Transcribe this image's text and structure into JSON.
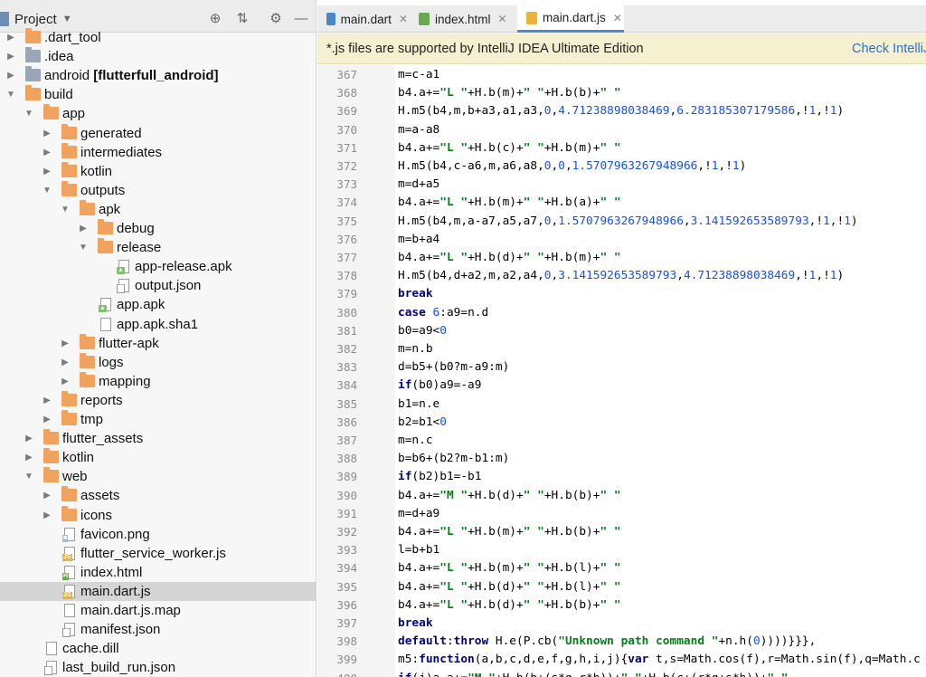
{
  "project_panel": {
    "title": "Project",
    "tree": [
      {
        "label": ".dart_tool",
        "depth": 1,
        "expander": "collapsed",
        "icon": "folder"
      },
      {
        "label": ".idea",
        "depth": 1,
        "expander": "collapsed",
        "icon": "folder-grey"
      },
      {
        "label": "android",
        "bold_suffix": "[flutterfull_android]",
        "depth": 1,
        "expander": "collapsed",
        "icon": "folder-grey"
      },
      {
        "label": "build",
        "depth": 1,
        "expander": "expanded",
        "icon": "folder"
      },
      {
        "label": "app",
        "depth": 2,
        "expander": "expanded",
        "icon": "folder"
      },
      {
        "label": "generated",
        "depth": 3,
        "expander": "collapsed",
        "icon": "folder"
      },
      {
        "label": "intermediates",
        "depth": 3,
        "expander": "collapsed",
        "icon": "folder"
      },
      {
        "label": "kotlin",
        "depth": 3,
        "expander": "collapsed",
        "icon": "folder"
      },
      {
        "label": "outputs",
        "depth": 3,
        "expander": "expanded",
        "icon": "folder"
      },
      {
        "label": "apk",
        "depth": 4,
        "expander": "expanded",
        "icon": "folder"
      },
      {
        "label": "debug",
        "depth": 5,
        "expander": "collapsed",
        "icon": "folder"
      },
      {
        "label": "release",
        "depth": 5,
        "expander": "expanded",
        "icon": "folder"
      },
      {
        "label": "app-release.apk",
        "depth": 6,
        "expander": "none",
        "icon": "apk"
      },
      {
        "label": "output.json",
        "depth": 6,
        "expander": "none",
        "icon": "json"
      },
      {
        "label": "app.apk",
        "depth": 5,
        "expander": "none",
        "icon": "apk"
      },
      {
        "label": "app.apk.sha1",
        "depth": 5,
        "expander": "none",
        "icon": "text"
      },
      {
        "label": "flutter-apk",
        "depth": 4,
        "expander": "collapsed",
        "icon": "folder"
      },
      {
        "label": "logs",
        "depth": 4,
        "expander": "collapsed",
        "icon": "folder"
      },
      {
        "label": "mapping",
        "depth": 4,
        "expander": "collapsed",
        "icon": "folder"
      },
      {
        "label": "reports",
        "depth": 3,
        "expander": "collapsed",
        "icon": "folder"
      },
      {
        "label": "tmp",
        "depth": 3,
        "expander": "collapsed",
        "icon": "folder"
      },
      {
        "label": "flutter_assets",
        "depth": 2,
        "expander": "collapsed",
        "icon": "folder"
      },
      {
        "label": "kotlin",
        "depth": 2,
        "expander": "collapsed",
        "icon": "folder"
      },
      {
        "label": "web",
        "depth": 2,
        "expander": "expanded",
        "icon": "folder"
      },
      {
        "label": "assets",
        "depth": 3,
        "expander": "collapsed",
        "icon": "folder"
      },
      {
        "label": "icons",
        "depth": 3,
        "expander": "collapsed",
        "icon": "folder"
      },
      {
        "label": "favicon.png",
        "depth": 3,
        "expander": "none",
        "icon": "png"
      },
      {
        "label": "flutter_service_worker.js",
        "depth": 3,
        "expander": "none",
        "icon": "js"
      },
      {
        "label": "index.html",
        "depth": 3,
        "expander": "none",
        "icon": "html"
      },
      {
        "label": "main.dart.js",
        "depth": 3,
        "expander": "none",
        "icon": "js",
        "selected": true
      },
      {
        "label": "main.dart.js.map",
        "depth": 3,
        "expander": "none",
        "icon": "text"
      },
      {
        "label": "manifest.json",
        "depth": 3,
        "expander": "none",
        "icon": "json"
      },
      {
        "label": "cache.dill",
        "depth": 2,
        "expander": "none",
        "icon": "text"
      },
      {
        "label": "last_build_run.json",
        "depth": 2,
        "expander": "none",
        "icon": "json"
      }
    ]
  },
  "editor": {
    "tabs": [
      {
        "label": "main.dart",
        "icon": "dart-icon",
        "active": false
      },
      {
        "label": "index.html",
        "icon": "html-file-icon",
        "active": false
      },
      {
        "label": "main.dart.js",
        "icon": "js-file-icon",
        "active": true
      }
    ],
    "banner": {
      "message": "*.js files are supported by IntelliJ IDEA Ultimate Edition",
      "link": "Check IntelliJ"
    },
    "lines": [
      {
        "n": "367",
        "t": [
          [
            "",
            "m=c-a1"
          ]
        ]
      },
      {
        "n": "368",
        "t": [
          [
            "",
            "b4.a+="
          ],
          [
            "str",
            "\"L \""
          ],
          [
            "",
            "+H.b(m)+"
          ],
          [
            "str",
            "\" \""
          ],
          [
            "",
            "+H.b(b)+"
          ],
          [
            "str",
            "\" \""
          ]
        ]
      },
      {
        "n": "369",
        "t": [
          [
            "",
            "H.m5(b4,m,b+a3,a1,a3,"
          ],
          [
            "num",
            "0"
          ],
          [
            "",
            ","
          ],
          [
            "num",
            "4.71238898038469"
          ],
          [
            "",
            ","
          ],
          [
            "num",
            "6.283185307179586"
          ],
          [
            "",
            ",!"
          ],
          [
            "num",
            "1"
          ],
          [
            "",
            ",!"
          ],
          [
            "num",
            "1"
          ],
          [
            "",
            ")"
          ]
        ]
      },
      {
        "n": "370",
        "t": [
          [
            "",
            "m=a-a8"
          ]
        ]
      },
      {
        "n": "371",
        "t": [
          [
            "",
            "b4.a+="
          ],
          [
            "str",
            "\"L \""
          ],
          [
            "",
            "+H.b(c)+"
          ],
          [
            "str",
            "\" \""
          ],
          [
            "",
            "+H.b(m)+"
          ],
          [
            "str",
            "\" \""
          ]
        ]
      },
      {
        "n": "372",
        "t": [
          [
            "",
            "H.m5(b4,c-a6,m,a6,a8,"
          ],
          [
            "num",
            "0"
          ],
          [
            "",
            ","
          ],
          [
            "num",
            "0"
          ],
          [
            "",
            ","
          ],
          [
            "num",
            "1.5707963267948966"
          ],
          [
            "",
            ",!"
          ],
          [
            "num",
            "1"
          ],
          [
            "",
            ",!"
          ],
          [
            "num",
            "1"
          ],
          [
            "",
            ")"
          ]
        ]
      },
      {
        "n": "373",
        "t": [
          [
            "",
            "m=d+a5"
          ]
        ]
      },
      {
        "n": "374",
        "t": [
          [
            "",
            "b4.a+="
          ],
          [
            "str",
            "\"L \""
          ],
          [
            "",
            "+H.b(m)+"
          ],
          [
            "str",
            "\" \""
          ],
          [
            "",
            "+H.b(a)+"
          ],
          [
            "str",
            "\" \""
          ]
        ]
      },
      {
        "n": "375",
        "t": [
          [
            "",
            "H.m5(b4,m,a-a7,a5,a7,"
          ],
          [
            "num",
            "0"
          ],
          [
            "",
            ","
          ],
          [
            "num",
            "1.5707963267948966"
          ],
          [
            "",
            ","
          ],
          [
            "num",
            "3.141592653589793"
          ],
          [
            "",
            ",!"
          ],
          [
            "num",
            "1"
          ],
          [
            "",
            ",!"
          ],
          [
            "num",
            "1"
          ],
          [
            "",
            ")"
          ]
        ]
      },
      {
        "n": "376",
        "t": [
          [
            "",
            "m=b+a4"
          ]
        ]
      },
      {
        "n": "377",
        "t": [
          [
            "",
            "b4.a+="
          ],
          [
            "str",
            "\"L \""
          ],
          [
            "",
            "+H.b(d)+"
          ],
          [
            "str",
            "\" \""
          ],
          [
            "",
            "+H.b(m)+"
          ],
          [
            "str",
            "\" \""
          ]
        ]
      },
      {
        "n": "378",
        "t": [
          [
            "",
            "H.m5(b4,d+a2,m,a2,a4,"
          ],
          [
            "num",
            "0"
          ],
          [
            "",
            ","
          ],
          [
            "num",
            "3.141592653589793"
          ],
          [
            "",
            ","
          ],
          [
            "num",
            "4.71238898038469"
          ],
          [
            "",
            ",!"
          ],
          [
            "num",
            "1"
          ],
          [
            "",
            ",!"
          ],
          [
            "num",
            "1"
          ],
          [
            "",
            ")"
          ]
        ]
      },
      {
        "n": "379",
        "t": [
          [
            "kw",
            "break"
          ]
        ]
      },
      {
        "n": "380",
        "t": [
          [
            "kw",
            "case "
          ],
          [
            "num",
            "6"
          ],
          [
            "",
            ":a9=n.d"
          ]
        ]
      },
      {
        "n": "381",
        "t": [
          [
            "",
            "b0=a9<"
          ],
          [
            "num",
            "0"
          ]
        ]
      },
      {
        "n": "382",
        "t": [
          [
            "",
            "m=n.b"
          ]
        ]
      },
      {
        "n": "383",
        "t": [
          [
            "",
            "d=b5+(b0?m-a9:m)"
          ]
        ]
      },
      {
        "n": "384",
        "t": [
          [
            "kw",
            "if"
          ],
          [
            "",
            "(b0)a9=-a9"
          ]
        ]
      },
      {
        "n": "385",
        "t": [
          [
            "",
            "b1=n.e"
          ]
        ]
      },
      {
        "n": "386",
        "t": [
          [
            "",
            "b2=b1<"
          ],
          [
            "num",
            "0"
          ]
        ]
      },
      {
        "n": "387",
        "t": [
          [
            "",
            "m=n.c"
          ]
        ]
      },
      {
        "n": "388",
        "t": [
          [
            "",
            "b=b6+(b2?m-b1:m)"
          ]
        ]
      },
      {
        "n": "389",
        "t": [
          [
            "kw",
            "if"
          ],
          [
            "",
            "(b2)b1=-b1"
          ]
        ]
      },
      {
        "n": "390",
        "t": [
          [
            "",
            "b4.a+="
          ],
          [
            "str",
            "\"M \""
          ],
          [
            "",
            "+H.b(d)+"
          ],
          [
            "str",
            "\" \""
          ],
          [
            "",
            "+H.b(b)+"
          ],
          [
            "str",
            "\" \""
          ]
        ]
      },
      {
        "n": "391",
        "t": [
          [
            "",
            "m=d+a9"
          ]
        ]
      },
      {
        "n": "392",
        "t": [
          [
            "",
            "b4.a+="
          ],
          [
            "str",
            "\"L \""
          ],
          [
            "",
            "+H.b(m)+"
          ],
          [
            "str",
            "\" \""
          ],
          [
            "",
            "+H.b(b)+"
          ],
          [
            "str",
            "\" \""
          ]
        ]
      },
      {
        "n": "393",
        "t": [
          [
            "",
            "l=b+b1"
          ]
        ]
      },
      {
        "n": "394",
        "t": [
          [
            "",
            "b4.a+="
          ],
          [
            "str",
            "\"L \""
          ],
          [
            "",
            "+H.b(m)+"
          ],
          [
            "str",
            "\" \""
          ],
          [
            "",
            "+H.b(l)+"
          ],
          [
            "str",
            "\" \""
          ]
        ]
      },
      {
        "n": "395",
        "t": [
          [
            "",
            "b4.a+="
          ],
          [
            "str",
            "\"L \""
          ],
          [
            "",
            "+H.b(d)+"
          ],
          [
            "str",
            "\" \""
          ],
          [
            "",
            "+H.b(l)+"
          ],
          [
            "str",
            "\" \""
          ]
        ]
      },
      {
        "n": "396",
        "t": [
          [
            "",
            "b4.a+="
          ],
          [
            "str",
            "\"L \""
          ],
          [
            "",
            "+H.b(d)+"
          ],
          [
            "str",
            "\" \""
          ],
          [
            "",
            "+H.b(b)+"
          ],
          [
            "str",
            "\" \""
          ]
        ]
      },
      {
        "n": "397",
        "t": [
          [
            "kw",
            "break"
          ]
        ]
      },
      {
        "n": "398",
        "t": [
          [
            "kw",
            "default"
          ],
          [
            "",
            ":"
          ],
          [
            "kw",
            "throw "
          ],
          [
            "",
            "H.e(P.cb("
          ],
          [
            "str",
            "\"Unknown path command \""
          ],
          [
            "",
            "+n.h("
          ],
          [
            "num",
            "0"
          ],
          [
            "",
            "))))}}},"
          ]
        ]
      },
      {
        "n": "399",
        "t": [
          [
            "",
            "m5:"
          ],
          [
            "kw",
            "function"
          ],
          [
            "",
            "(a,b,c,d,e,f,g,h,i,j){"
          ],
          [
            "kw",
            "var "
          ],
          [
            "",
            "t,s=Math.cos(f),r=Math.sin(f),q=Math.c"
          ]
        ]
      },
      {
        "n": "400",
        "t": [
          [
            "kw",
            "if"
          ],
          [
            "",
            "(j)a.a+="
          ],
          [
            "str",
            "\"M \""
          ],
          [
            "",
            "+H.b(b+(s*g-r*h))+"
          ],
          [
            "str",
            "\" \""
          ],
          [
            "",
            "+H.b(c+(r*g+s*h))+"
          ],
          [
            "str",
            "\" \""
          ]
        ]
      }
    ]
  }
}
